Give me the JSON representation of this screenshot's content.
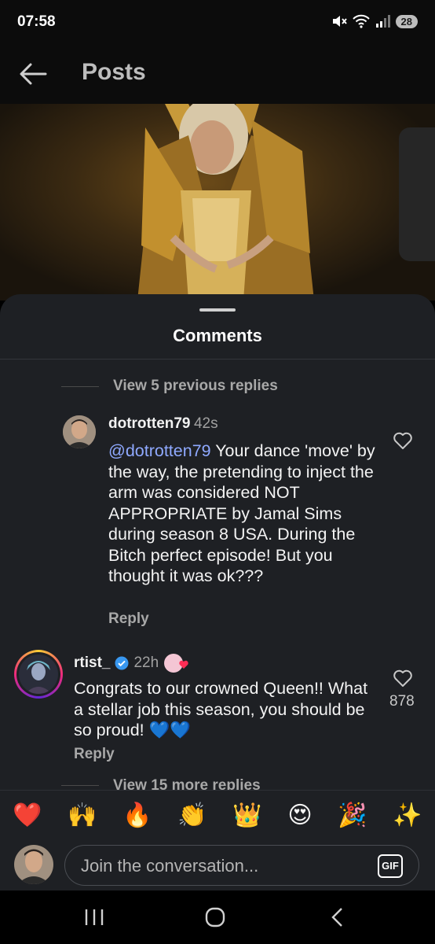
{
  "status_bar": {
    "time": "07:58",
    "battery": "28"
  },
  "header": {
    "title": "Posts"
  },
  "sheet": {
    "title": "Comments"
  },
  "thread": {
    "view_previous": "View 5 previous replies",
    "reply1": {
      "username": "dotrotten79",
      "time": "42s",
      "mention": "@dotrotten79",
      "text": " Your dance 'move' by the way, the pretending to inject the arm was considered NOT APPROPRIATE by Jamal Sims during season 8 USA. During the Bitch perfect episode! But you thought it was ok???",
      "reply_label": "Reply"
    },
    "comment2": {
      "username": "rtist_",
      "time": "22h",
      "text": "Congrats to our crowned Queen!! What a stellar job this season, you should be so proud! 💙💙",
      "reply_label": "Reply",
      "likes": "878"
    },
    "view_more": "View 15 more replies"
  },
  "emoji_bar": [
    "❤️",
    "🙌",
    "🔥",
    "👏",
    "👑",
    "😍",
    "🎉",
    "✨"
  ],
  "composer": {
    "placeholder": "Join the conversation...",
    "gif_label": "GIF"
  },
  "colors": {
    "sheet_bg": "#1e2024",
    "mention": "#8fa9ff",
    "verified": "#3897f0"
  }
}
